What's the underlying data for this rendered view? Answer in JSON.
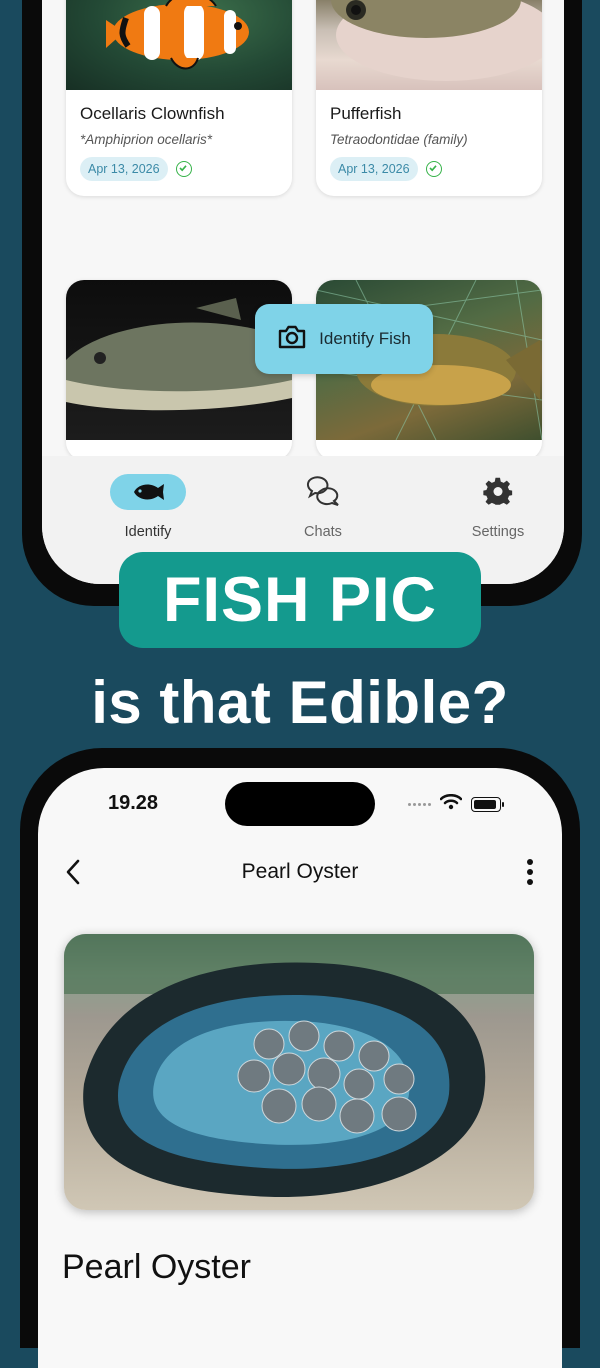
{
  "top_screen": {
    "cards": [
      {
        "name": "Ocellaris Clownfish",
        "scientific": "*Amphiprion ocellaris*",
        "date": "Apr 13, 2026"
      },
      {
        "name": "Pufferfish",
        "scientific": "Tetraodontidae (family)",
        "date": "Apr 13, 2026"
      },
      {
        "name": "",
        "scientific": "",
        "date": ""
      },
      {
        "name": "",
        "scientific": "",
        "date": ""
      }
    ],
    "fab_label": "Identify Fish",
    "nav": [
      {
        "label": "Identify",
        "icon": "fish-icon",
        "active": true
      },
      {
        "label": "Chats",
        "icon": "chat-bubbles-icon",
        "active": false
      },
      {
        "label": "Settings",
        "icon": "gear-icon",
        "active": false
      }
    ]
  },
  "headline": {
    "banner": "FISH PIC",
    "subtitle": "is that Edible?"
  },
  "bottom_screen": {
    "status_time": "19.28",
    "header_title": "Pearl Oyster",
    "detail_title": "Pearl Oyster"
  },
  "colors": {
    "background": "#1a4a5e",
    "banner": "#149a8e",
    "accent": "#7fd3e8",
    "date_pill": "#dceff5",
    "check": "#37b34a"
  }
}
